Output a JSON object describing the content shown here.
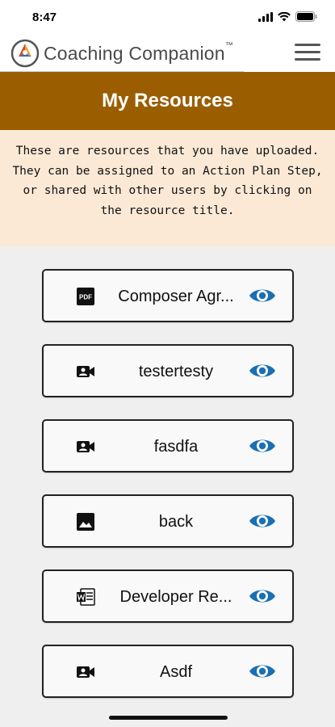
{
  "status_bar": {
    "time": "8:47"
  },
  "header": {
    "app_title": "Coaching Companion",
    "trademark": "™"
  },
  "page": {
    "title": "My Resources",
    "intro": "These are resources that you have uploaded. They can be assigned to an Action Plan Step, or shared with other users by clicking on the resource title."
  },
  "resources": [
    {
      "title": "Composer Agr...",
      "type_icon": "pdf-icon"
    },
    {
      "title": "testertesty",
      "type_icon": "video-icon"
    },
    {
      "title": "fasdfa",
      "type_icon": "video-icon"
    },
    {
      "title": "back",
      "type_icon": "image-icon"
    },
    {
      "title": "Developer Re...",
      "type_icon": "word-document-icon"
    },
    {
      "title": "Asdf",
      "type_icon": "video-icon"
    }
  ],
  "colors": {
    "title_bar": "#9a5e00",
    "intro_bg": "#fbe9d6",
    "eye_icon": "#1a6fb5"
  }
}
